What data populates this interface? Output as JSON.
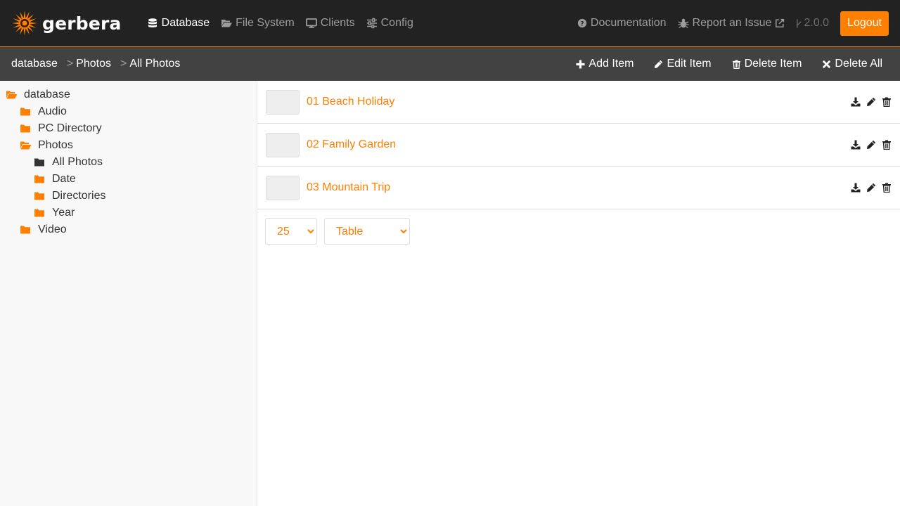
{
  "app": {
    "brand": "gerbera",
    "accent_color": "#ff7f00",
    "navbar_color": "#222222"
  },
  "nav": {
    "left": [
      {
        "label": "Database",
        "icon": "database-icon",
        "active": true
      },
      {
        "label": "File System",
        "icon": "folder-open-icon",
        "active": false
      },
      {
        "label": "Clients",
        "icon": "desktop-icon",
        "active": false
      },
      {
        "label": "Config",
        "icon": "sliders-icon",
        "active": false
      }
    ],
    "documentation": "Documentation",
    "report_issue": "Report an Issue",
    "version": "2.0.0",
    "logout": "Logout"
  },
  "breadcrumb": {
    "root": "database",
    "items": [
      "Photos",
      "All Photos"
    ],
    "separator": ">"
  },
  "actions": {
    "add": "Add Item",
    "edit": "Edit Item",
    "delete": "Delete Item",
    "delete_all": "Delete All"
  },
  "tree": {
    "root": "database",
    "children": [
      {
        "label": "Audio"
      },
      {
        "label": "PC Directory"
      },
      {
        "label": "Photos",
        "expanded": true,
        "children": [
          {
            "label": "All Photos",
            "selected": true
          },
          {
            "label": "Date"
          },
          {
            "label": "Directories"
          },
          {
            "label": "Year"
          }
        ]
      },
      {
        "label": "Video"
      }
    ]
  },
  "items": [
    {
      "title": "01 Beach Holiday"
    },
    {
      "title": "02 Family Garden"
    },
    {
      "title": "03 Mountain Trip"
    }
  ],
  "pager": {
    "per_page": "25",
    "view_mode": "Table"
  }
}
